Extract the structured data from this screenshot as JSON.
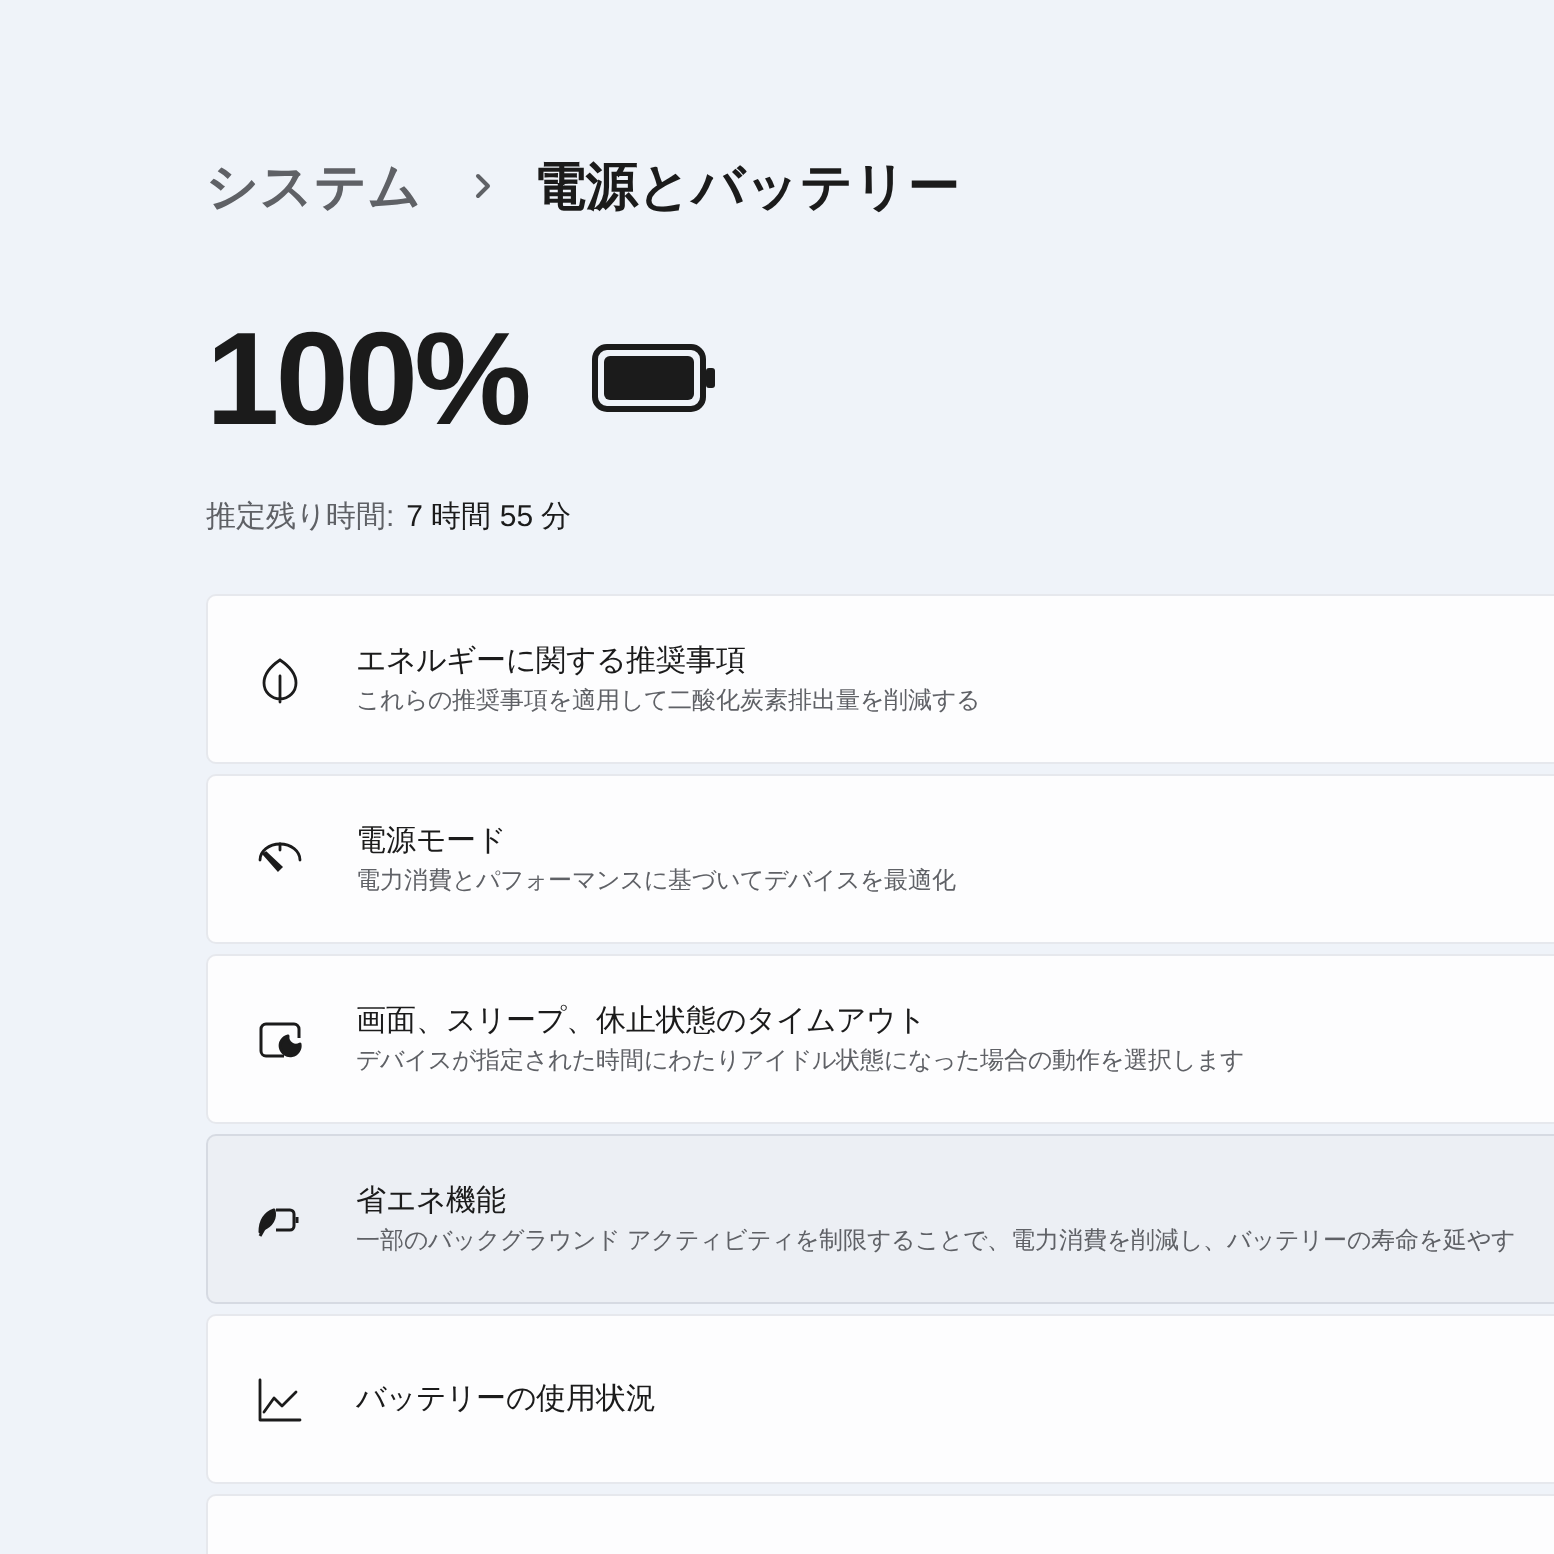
{
  "breadcrumb": {
    "parent": "システム",
    "current": "電源とバッテリー"
  },
  "battery": {
    "percent": "100%",
    "remaining_label": "推定残り時間:",
    "remaining_value": "7 時間 55 分"
  },
  "cards": [
    {
      "kind": "leaf",
      "title": "エネルギーに関する推奨事項",
      "subtitle": "これらの推奨事項を適用して二酸化炭素排出量を削減する",
      "highlighted": false
    },
    {
      "kind": "gauge",
      "title": "電源モード",
      "subtitle": "電力消費とパフォーマンスに基づいてデバイスを最適化",
      "highlighted": false
    },
    {
      "kind": "screen-moon",
      "title": "画面、スリープ、休止状態のタイムアウト",
      "subtitle": "デバイスが指定された時間にわたりアイドル状態になった場合の動作を選択します",
      "highlighted": false
    },
    {
      "kind": "battery-leaf",
      "title": "省エネ機能",
      "subtitle": "一部のバックグラウンド アクティビティを制限することで、電力消費を削減し、バッテリーの寿命を延やす",
      "highlighted": true
    },
    {
      "kind": "chart",
      "title": "バッテリーの使用状況",
      "highlighted": false
    },
    {
      "kind": "blank",
      "highlighted": false
    }
  ]
}
